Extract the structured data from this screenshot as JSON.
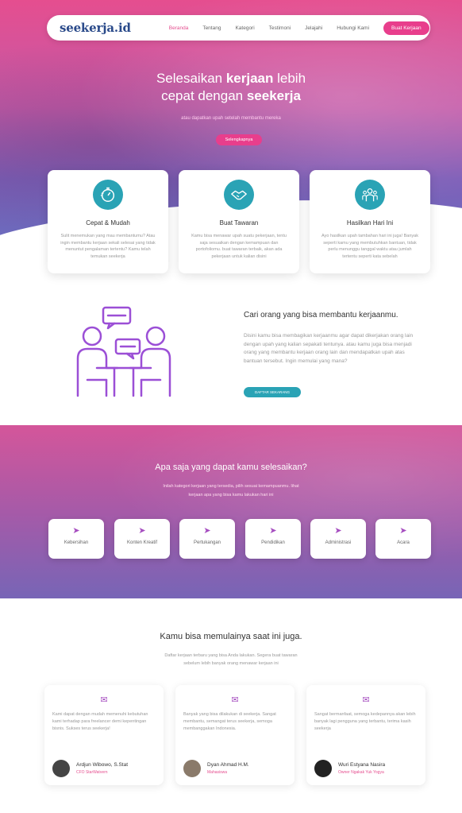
{
  "brand": {
    "logo": "seekerja.id"
  },
  "nav": {
    "links": [
      "Beranda",
      "Tentang",
      "Kategori",
      "Testimoni",
      "Jelajahi",
      "Hubungi Kami"
    ],
    "cta": "Buat Kerjaan"
  },
  "hero": {
    "title_line1_pre": "Selesaikan ",
    "title_line1_bold": "kerjaan",
    "title_line1_post": " lebih",
    "title_line2_pre": "cepat dengan ",
    "title_line2_bold": "seekerja",
    "subtitle": "atau dapatkan upah setelah membantu mereka",
    "button": "Selengkapnya"
  },
  "features": [
    {
      "icon": "stopwatch-icon",
      "title": "Cepat & Mudah",
      "desc": "Sulit menemukan yang mau membantumu? Atau ingin membantu kerjaan sekali selesai yang tidak menuntut pengalaman tertentu? Kamu telah temukan seekerja"
    },
    {
      "icon": "handshake-icon",
      "title": "Buat Tawaran",
      "desc": "Kamu bisa menawar upah suatu pekerjaan, tentu saja sesuaikan dengan kemampuan dan portofoliomu. buat tawaran terbaik, akan ada pekerjaan untuk kalian disini"
    },
    {
      "icon": "team-icon",
      "title": "Hasilkan Hari Ini",
      "desc": "Ayo hasilkan upah tambahan hari ini juga! Banyak seperti kamu yang membutuhkan bantuan, tidak perlu menunggu tanggal waktu atau jumlah tertentu seperti kata sebelah"
    }
  ],
  "people": {
    "title": "Cari orang yang bisa membantu kerjaanmu.",
    "desc": "Disini kamu bisa membagikan kerjaanmu agar dapat dikerjakan orang lain dengan upah yang kalian sepakati tentunya. atau kamu juga bisa menjadi orang yang membantu kerjaan orang lain dan mendapatkan upah atas bantuan tersebut. Ingin memulai yang mana?",
    "button": "DAFTAR SEKARANG"
  },
  "categories": {
    "title": "Apa saja yang dapat kamu selesaikan?",
    "sub_line1": "Inilah kategori kerjaan yang tersedia, pilih sesuai kemampuanmu. lihat",
    "sub_line2": "kerjaan apa yang bisa kamu lakukan hari ini",
    "items": [
      "Kebersihan",
      "Konten Kreatif",
      "Pertukangan",
      "Pendidikan",
      "Administrasi",
      "Acara"
    ]
  },
  "testimonials": {
    "title": "Kamu bisa memulainya saat ini juga.",
    "sub_line1": "Daftar kerjaan terbaru yang bisa Anda lakukan. Segera buat tawaran",
    "sub_line2": "sebelum lebih banyak orang menawar kerjaan ini",
    "items": [
      {
        "text": "Kami dapat dengan mudah memenuhi kebutuhan kami terhadap para freelancer demi kepentingan bisnis. Sukses terus seekerja!",
        "name": "Ardjun Wibowo, S.Stat",
        "role": "CFO StarWatvern"
      },
      {
        "text": "Banyak yang bisa dilakukan di seekerja. Sangat membantu, semangat terus seekerja, semoga membanggakan Indonesia.",
        "name": "Dyan Ahmad H.M.",
        "role": "Mahasiswa"
      },
      {
        "text": "Sangat bermanfaat, semoga kedepannya akan lebih banyak lagi pengguna yang terbantu, terima kasih seekerja",
        "name": "Wuri Estyana Nasira",
        "role": "Owner Ngakak Yuk Yogya"
      }
    ]
  },
  "colors": {
    "pink": "#e83e8c",
    "teal": "#2aa3b5",
    "purple": "#a64ec0",
    "logo": "#2a4a8a"
  }
}
